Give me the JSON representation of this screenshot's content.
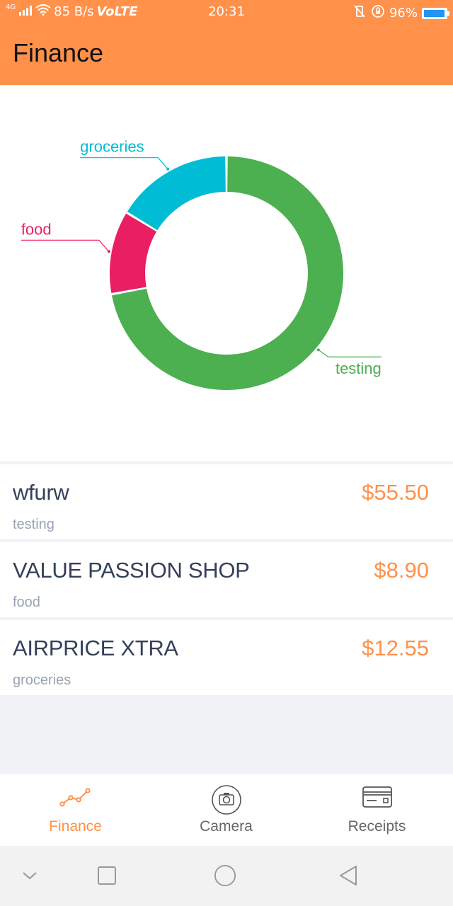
{
  "status_bar": {
    "network": "4G",
    "speed": "85 B/s",
    "volte": "VoLTE",
    "time": "20:31",
    "battery_percent": "96%",
    "battery_level": 0.96,
    "battery_color": "#2196f3"
  },
  "app_bar": {
    "title": "Finance",
    "background": "#ff914a"
  },
  "chart_data": {
    "type": "pie",
    "donut": true,
    "slices": [
      {
        "label": "testing",
        "value": 55.5,
        "color": "#4caf50"
      },
      {
        "label": "food",
        "value": 8.9,
        "color": "#e91e63"
      },
      {
        "label": "groceries",
        "value": 12.55,
        "color": "#00bcd4"
      }
    ],
    "legend": "outside labels with leader lines"
  },
  "transactions": [
    {
      "title": "wfurw",
      "amount": "$55.50",
      "category": "testing"
    },
    {
      "title": "VALUE PASSION SHOP",
      "amount": "$8.90",
      "category": "food"
    },
    {
      "title": "AIRPRICE XTRA",
      "amount": "$12.55",
      "category": "groceries"
    }
  ],
  "bottom_nav": {
    "items": [
      {
        "label": "Finance",
        "icon": "trend-line-icon",
        "active": true
      },
      {
        "label": "Camera",
        "icon": "camera-icon",
        "active": false
      },
      {
        "label": "Receipts",
        "icon": "card-icon",
        "active": false
      }
    ],
    "active_color": "#ff914a"
  },
  "system_nav": {
    "buttons": [
      "chevron-down-icon",
      "recents-icon",
      "home-icon",
      "back-icon"
    ]
  }
}
